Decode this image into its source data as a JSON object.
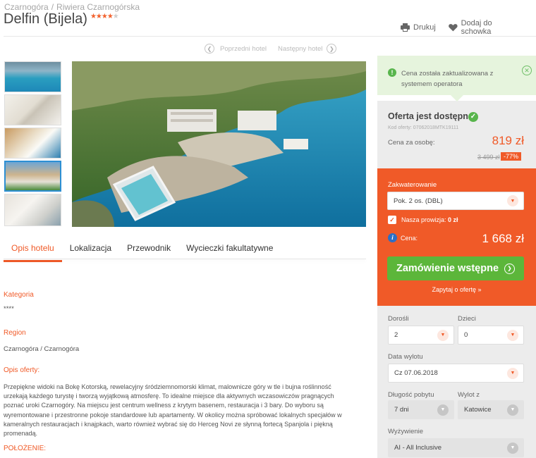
{
  "breadcrumb": [
    "Czarnogóra",
    "Riwiera Czarnogórska"
  ],
  "hotel": {
    "name": "Delfin (Bijela)",
    "stars": 4,
    "max_stars": 5
  },
  "header_actions": {
    "print": "Drukuj",
    "favorite": "Dodaj do schowka"
  },
  "hotel_nav": {
    "prev": "Poprzedni hotel",
    "next": "Następny hotel"
  },
  "tabs": [
    "Opis hotelu",
    "Lokalizacja",
    "Przewodnik",
    "Wycieczki fakultatywne"
  ],
  "details": {
    "category_label": "Kategoria",
    "category_value": "****",
    "region_label": "Region",
    "region_value": "Czarnogóra / Czarnogóra",
    "offer_desc_label": "Opis oferty:",
    "offer_desc": "Przepiękne widoki na Bokę Kotorską, rewelacyjny śródziemnomorski klimat, malownicze góry w tle i bujna roślinność urzekają każdego turystę i tworzą wyjątkową atmosferę. To idealne miejsce dla aktywnych wczasowiczów pragnących poznać uroki Czarnogóry. Na miejscu jest centrum wellness z krytym basenem, restauracja i 3 bary. Do wyboru są wyremontowane i przestronne pokoje standardowe lub apartamenty. W okolicy można spróbować lokalnych specjałów w kameralnych restauracjach i knajpkach, warto również wybrać się do Herceg Novi ze słynną fortecą Spanjola i piękną promenadą.",
    "location_label": "POŁOŻENIE:"
  },
  "notice": {
    "text": "Cena została zaktualizowana z systemem operatora"
  },
  "offer": {
    "headline": "Oferta jest dostępna!",
    "code": "Kod oferty: 07062018MTK19111",
    "per_person_label": "Cena za osobę:",
    "price": "819 zł",
    "old_price": "3 499 zł",
    "discount": "-77%"
  },
  "booking": {
    "room_label": "Zakwaterowanie",
    "room_value": "Pok. 2 os. (DBL)",
    "commission_label": "Nasza prowizja:",
    "commission_value": "0 zł",
    "total_label": "Cena:",
    "total_value": "1 668 zł",
    "order_button": "Zamówienie wstępne",
    "ask_link": "Zapytaj o ofertę »"
  },
  "form": {
    "adults_label": "Dorośli",
    "adults_value": "2",
    "children_label": "Dzieci",
    "children_value": "0",
    "departure_label": "Data wylotu",
    "departure_value": "Cz 07.06.2018",
    "duration_label": "Długość pobytu",
    "duration_value": "7 dni",
    "from_label": "Wylot z",
    "from_value": "Katowice",
    "board_label": "Wyżywienie",
    "board_value": "AI - All Inclusive"
  },
  "colors": {
    "accent": "#f05a28",
    "success": "#5cb63a",
    "panel": "#ececec",
    "notice": "#e6f4dd"
  },
  "icons": [
    "printer-icon",
    "heart-icon",
    "chevron-left-icon",
    "chevron-right-icon",
    "check-icon",
    "close-icon",
    "chevron-down-icon",
    "info-icon",
    "arrow-right-icon"
  ]
}
